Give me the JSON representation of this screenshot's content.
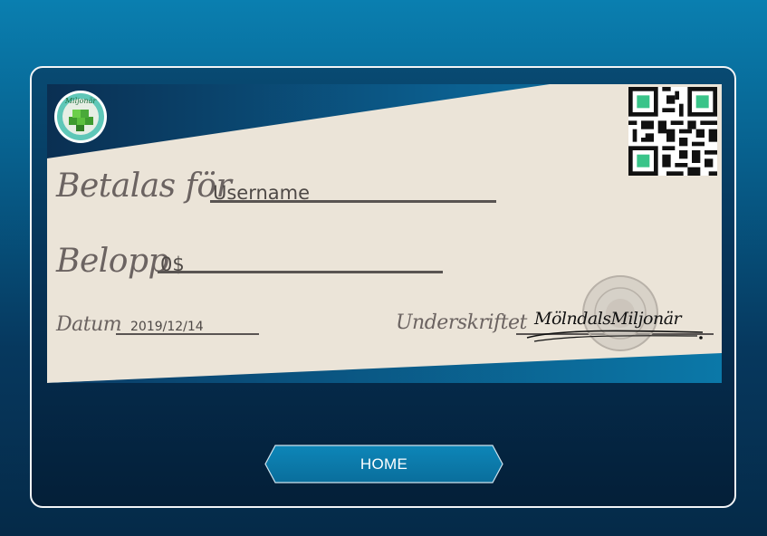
{
  "check": {
    "pay_to_label": "Betalas för",
    "pay_to_value": "Username",
    "amount_label": "Belopp",
    "amount_value": "0$",
    "date_label": "Datum",
    "date_value": "2019/12/14",
    "signature_label": "Underskriftet",
    "signature_value": "MölndalsMiljonär",
    "logo_text": "Miljonär"
  },
  "icons": {
    "logo": "miljonar-logo-icon",
    "qr": "qr-code-icon",
    "stamp": "stamp-seal-icon"
  },
  "nav": {
    "home_label": "HOME"
  },
  "colors": {
    "check_paper": "#ebe4d8",
    "check_band": "#0a6f9e",
    "button": "#0b79a8",
    "frame_border": "#f2f4f6"
  }
}
